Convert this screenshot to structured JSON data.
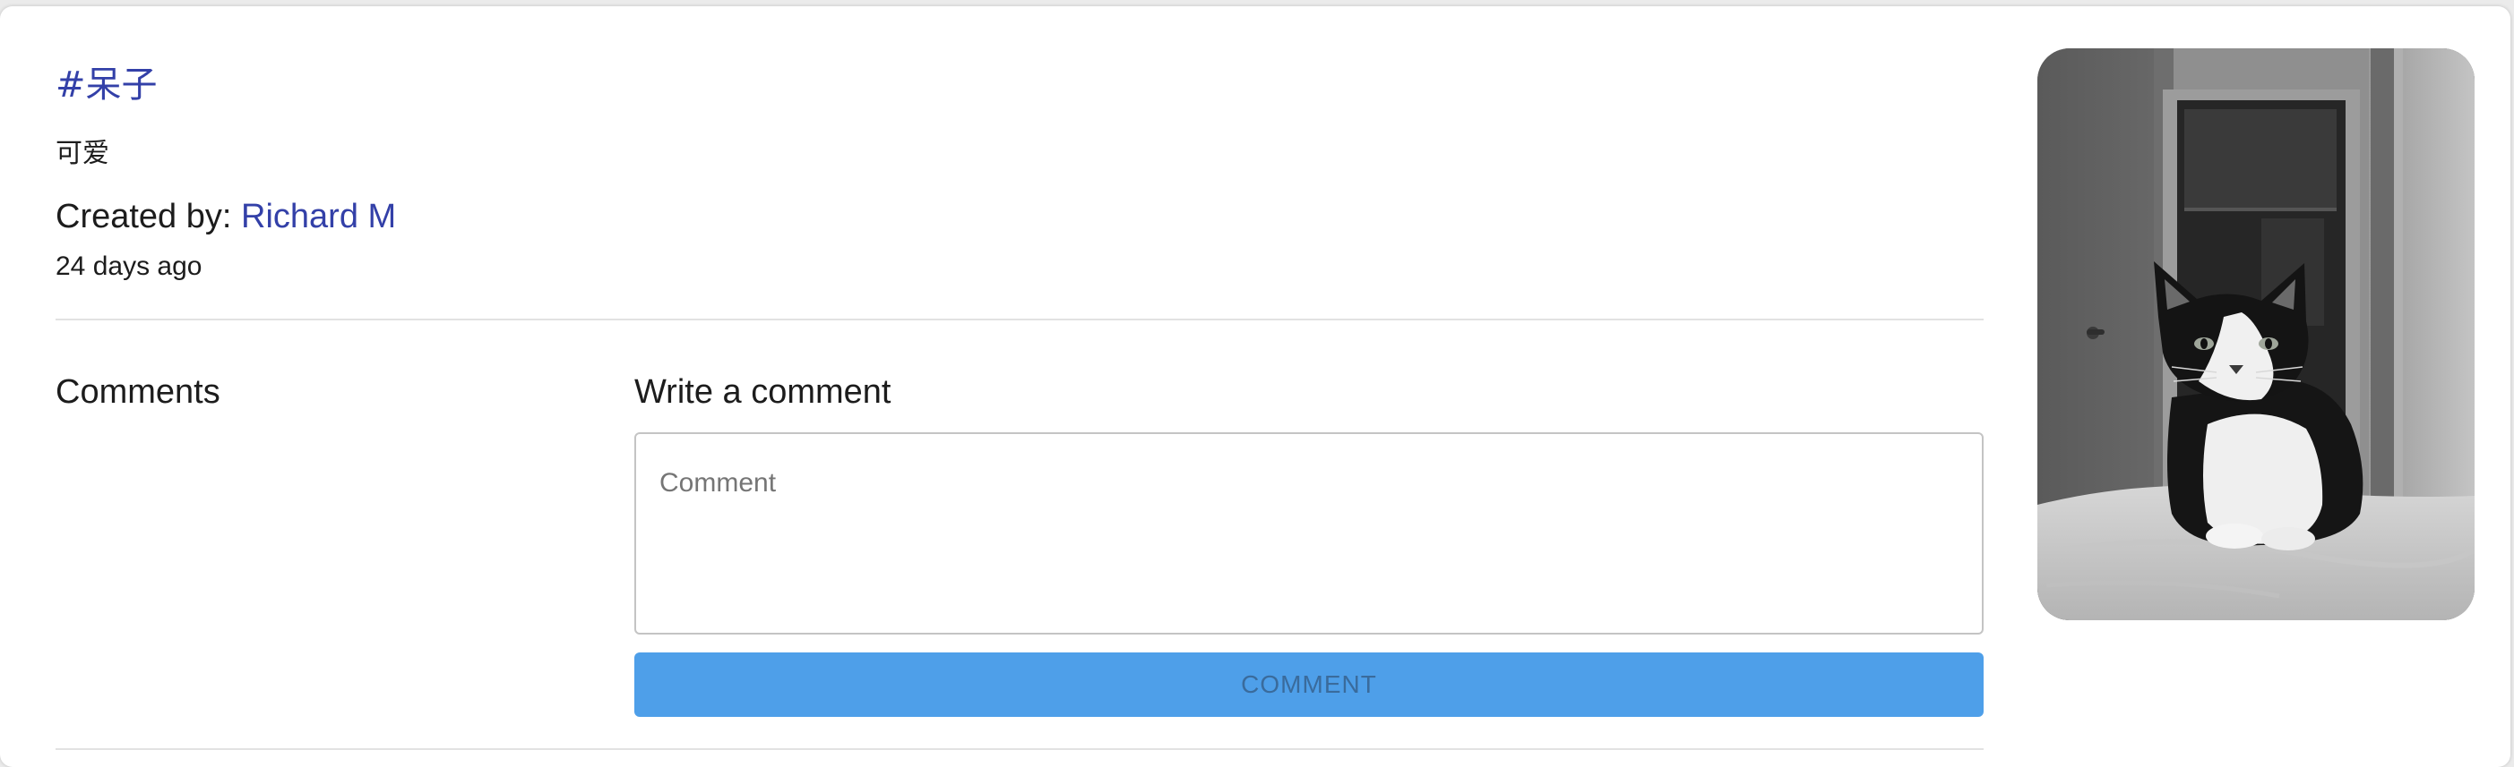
{
  "post": {
    "tag": "#呆子",
    "description": "可爱",
    "created_by_label": "Created by:",
    "author": "Richard M",
    "time_ago": "24 days ago"
  },
  "comments": {
    "heading": "Comments",
    "write_heading": "Write a comment",
    "input_value": "",
    "input_placeholder": "Comment",
    "submit_label": "COMMENT"
  },
  "photo": {
    "subject": "black-and-white cat sitting on a bed",
    "palette": "grayscale"
  },
  "colors": {
    "link": "#3340a8",
    "button": "#4e9fe9",
    "button_text": "#3a6b9c",
    "divider": "#e2e2e2"
  }
}
